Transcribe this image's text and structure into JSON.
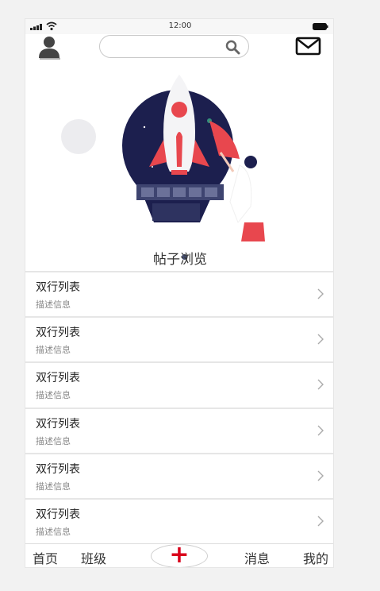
{
  "status_bar": {
    "time": "12:00"
  },
  "header": {
    "search": {
      "placeholder": "",
      "value": ""
    }
  },
  "banner": {
    "slide_count": 2,
    "active_slide": 1
  },
  "section": {
    "title": "帖子浏览"
  },
  "list": {
    "items": [
      {
        "title": "双行列表",
        "desc": "描述信息"
      },
      {
        "title": "双行列表",
        "desc": "描述信息"
      },
      {
        "title": "双行列表",
        "desc": "描述信息"
      },
      {
        "title": "双行列表",
        "desc": "描述信息"
      },
      {
        "title": "双行列表",
        "desc": "描述信息"
      },
      {
        "title": "双行列表",
        "desc": "描述信息"
      }
    ]
  },
  "tabbar": {
    "home": "首页",
    "class": "班级",
    "add": "+",
    "messages": "消息",
    "me": "我的"
  },
  "colors": {
    "accent": "#d9001b",
    "banner_dark": "#1c1f4e",
    "rocket_red": "#e8474e"
  },
  "icons": [
    "signal-icon",
    "wifi-icon",
    "battery-icon",
    "user-icon",
    "search-icon",
    "mail-icon",
    "chevron-right-icon"
  ]
}
